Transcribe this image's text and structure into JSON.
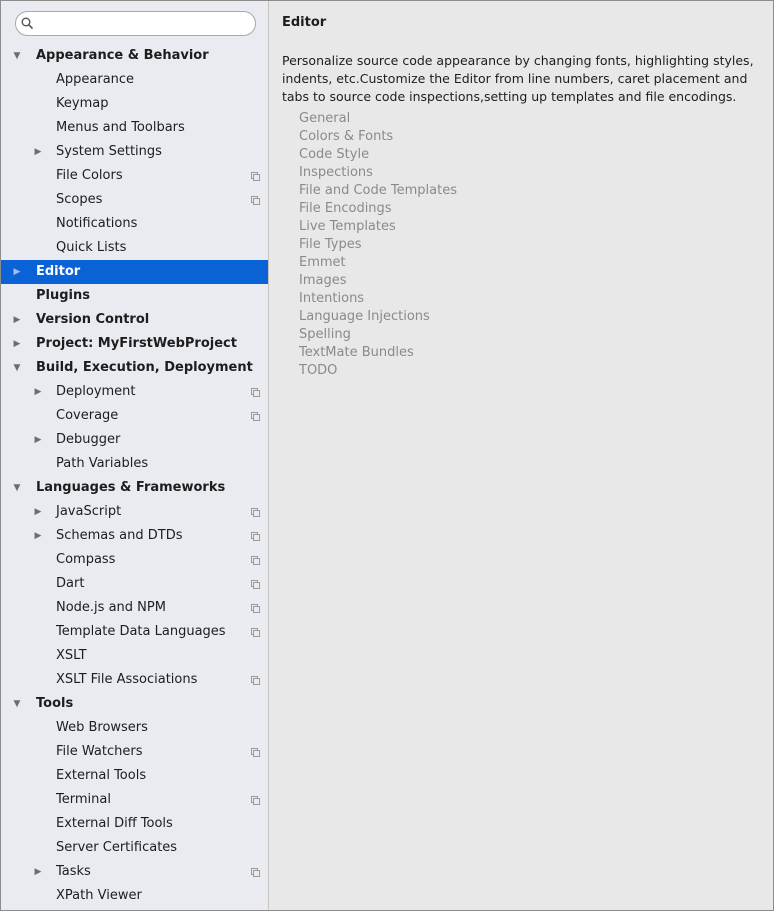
{
  "search": {
    "value": "",
    "placeholder": ""
  },
  "tree": [
    {
      "label": "Appearance & Behavior",
      "level": 0,
      "arrow": "▼",
      "selected": false,
      "project": false
    },
    {
      "label": "Appearance",
      "level": 1,
      "arrow": "",
      "selected": false,
      "project": false
    },
    {
      "label": "Keymap",
      "level": 1,
      "arrow": "",
      "selected": false,
      "project": false
    },
    {
      "label": "Menus and Toolbars",
      "level": 1,
      "arrow": "",
      "selected": false,
      "project": false
    },
    {
      "label": "System Settings",
      "level": 1,
      "arrow": "▶",
      "selected": false,
      "project": false
    },
    {
      "label": "File Colors",
      "level": 1,
      "arrow": "",
      "selected": false,
      "project": true
    },
    {
      "label": "Scopes",
      "level": 1,
      "arrow": "",
      "selected": false,
      "project": true
    },
    {
      "label": "Notifications",
      "level": 1,
      "arrow": "",
      "selected": false,
      "project": false
    },
    {
      "label": "Quick Lists",
      "level": 1,
      "arrow": "",
      "selected": false,
      "project": false
    },
    {
      "label": "Editor",
      "level": 0,
      "arrow": "▶",
      "selected": true,
      "project": false
    },
    {
      "label": "Plugins",
      "level": 0,
      "arrow": "",
      "selected": false,
      "project": false
    },
    {
      "label": "Version Control",
      "level": 0,
      "arrow": "▶",
      "selected": false,
      "project": false
    },
    {
      "label": "Project: MyFirstWebProject",
      "level": 0,
      "arrow": "▶",
      "selected": false,
      "project": false
    },
    {
      "label": "Build, Execution, Deployment",
      "level": 0,
      "arrow": "▼",
      "selected": false,
      "project": false
    },
    {
      "label": "Deployment",
      "level": 1,
      "arrow": "▶",
      "selected": false,
      "project": true
    },
    {
      "label": "Coverage",
      "level": 1,
      "arrow": "",
      "selected": false,
      "project": true
    },
    {
      "label": "Debugger",
      "level": 1,
      "arrow": "▶",
      "selected": false,
      "project": false
    },
    {
      "label": "Path Variables",
      "level": 1,
      "arrow": "",
      "selected": false,
      "project": false
    },
    {
      "label": "Languages & Frameworks",
      "level": 0,
      "arrow": "▼",
      "selected": false,
      "project": false
    },
    {
      "label": "JavaScript",
      "level": 1,
      "arrow": "▶",
      "selected": false,
      "project": true
    },
    {
      "label": "Schemas and DTDs",
      "level": 1,
      "arrow": "▶",
      "selected": false,
      "project": true
    },
    {
      "label": "Compass",
      "level": 1,
      "arrow": "",
      "selected": false,
      "project": true
    },
    {
      "label": "Dart",
      "level": 1,
      "arrow": "",
      "selected": false,
      "project": true
    },
    {
      "label": "Node.js and NPM",
      "level": 1,
      "arrow": "",
      "selected": false,
      "project": true
    },
    {
      "label": "Template Data Languages",
      "level": 1,
      "arrow": "",
      "selected": false,
      "project": true
    },
    {
      "label": "XSLT",
      "level": 1,
      "arrow": "",
      "selected": false,
      "project": false
    },
    {
      "label": "XSLT File Associations",
      "level": 1,
      "arrow": "",
      "selected": false,
      "project": true
    },
    {
      "label": "Tools",
      "level": 0,
      "arrow": "▼",
      "selected": false,
      "project": false
    },
    {
      "label": "Web Browsers",
      "level": 1,
      "arrow": "",
      "selected": false,
      "project": false
    },
    {
      "label": "File Watchers",
      "level": 1,
      "arrow": "",
      "selected": false,
      "project": true
    },
    {
      "label": "External Tools",
      "level": 1,
      "arrow": "",
      "selected": false,
      "project": false
    },
    {
      "label": "Terminal",
      "level": 1,
      "arrow": "",
      "selected": false,
      "project": true
    },
    {
      "label": "External Diff Tools",
      "level": 1,
      "arrow": "",
      "selected": false,
      "project": false
    },
    {
      "label": "Server Certificates",
      "level": 1,
      "arrow": "",
      "selected": false,
      "project": false
    },
    {
      "label": "Tasks",
      "level": 1,
      "arrow": "▶",
      "selected": false,
      "project": true
    },
    {
      "label": "XPath Viewer",
      "level": 1,
      "arrow": "",
      "selected": false,
      "project": false
    }
  ],
  "content": {
    "title": "Editor",
    "description": "Personalize source code appearance by changing fonts, highlighting styles, indents, etc.Customize the Editor from line numbers, caret placement and tabs to source code inspections,setting up templates and file encodings.",
    "links": [
      "General",
      "Colors & Fonts",
      "Code Style",
      "Inspections",
      "File and Code Templates",
      "File Encodings",
      "Live Templates",
      "File Types",
      "Emmet",
      "Images",
      "Intentions",
      "Language Injections",
      "Spelling",
      "TextMate Bundles",
      "TODO"
    ]
  },
  "colors": {
    "selection": "#0a63d6",
    "sidebar_bg": "#e9ebf0",
    "content_bg": "#e8e8e8",
    "link_text": "#8a8a8a"
  },
  "icons": {
    "search": "search-icon",
    "expand": "expand-arrow-icon",
    "collapse": "collapse-arrow-icon",
    "project_level": "project-level-icon"
  }
}
